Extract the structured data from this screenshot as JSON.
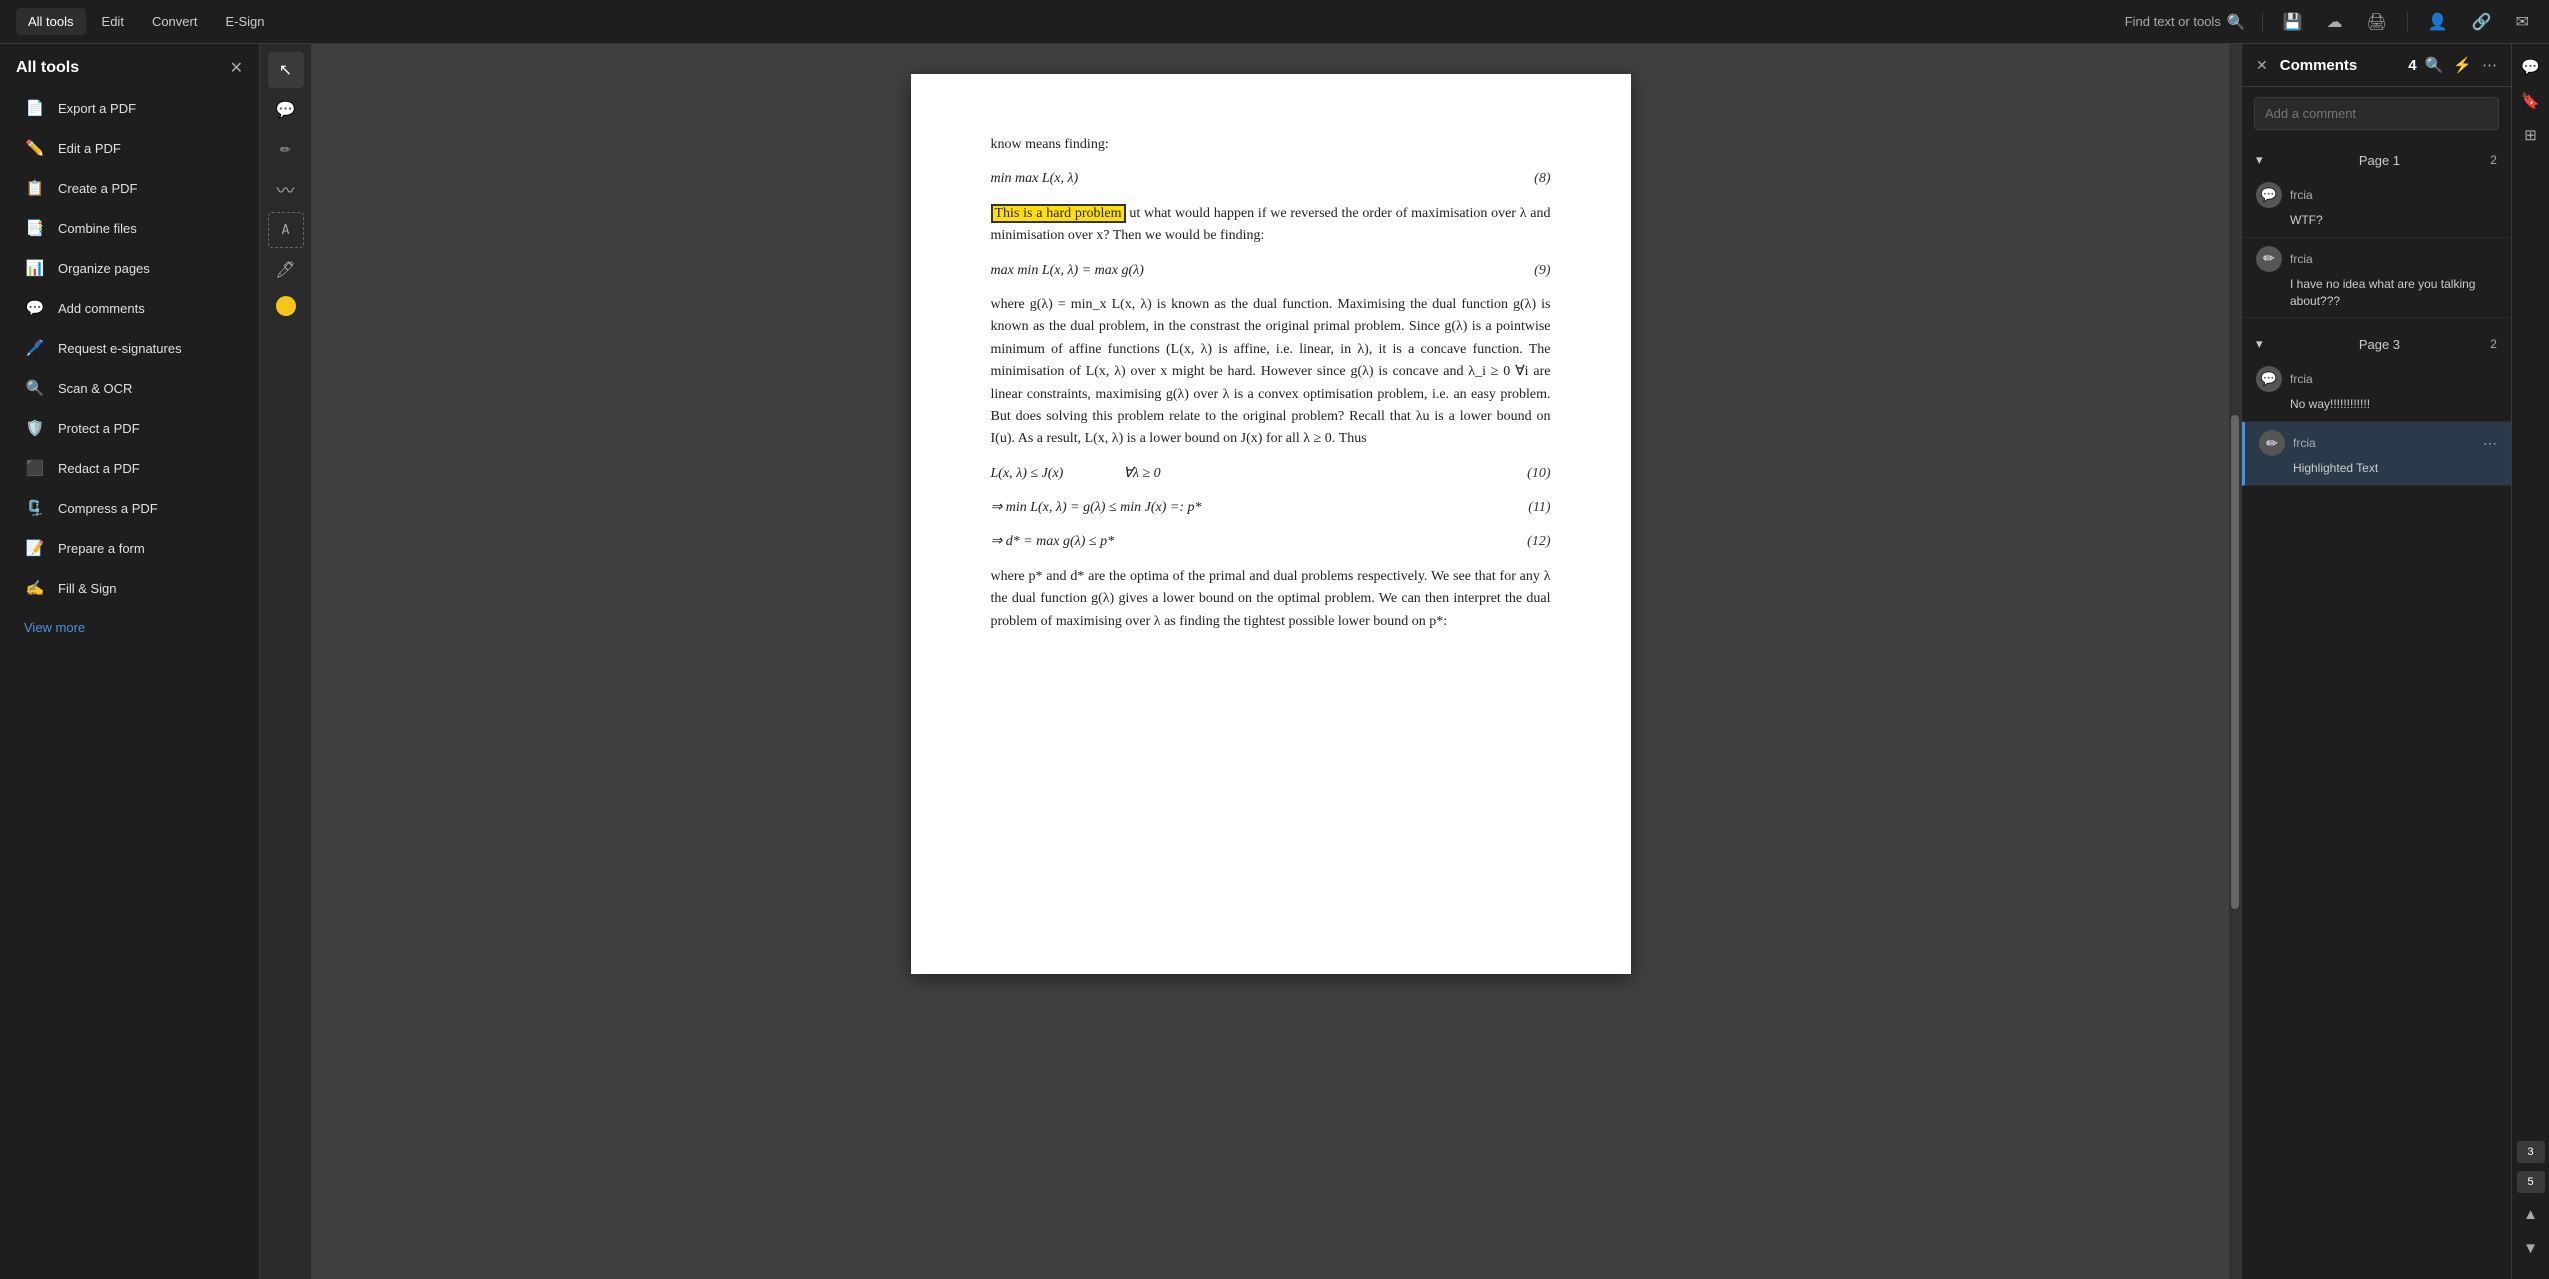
{
  "topbar": {
    "tabs": [
      {
        "label": "All tools",
        "active": true
      },
      {
        "label": "Edit",
        "active": false
      },
      {
        "label": "Convert",
        "active": false
      },
      {
        "label": "E-Sign",
        "active": false
      }
    ],
    "search_placeholder": "Find text or tools",
    "icons": [
      "save-icon",
      "upload-icon",
      "print-icon",
      "account-icon",
      "link-icon",
      "email-icon"
    ]
  },
  "sidebar": {
    "title": "All tools",
    "tools": [
      {
        "id": "export-pdf",
        "label": "Export a PDF",
        "icon": "📄",
        "color": "icon-export"
      },
      {
        "id": "edit-pdf",
        "label": "Edit a PDF",
        "icon": "✏️",
        "color": "icon-edit"
      },
      {
        "id": "create-pdf",
        "label": "Create a PDF",
        "icon": "📋",
        "color": "icon-create"
      },
      {
        "id": "combine-files",
        "label": "Combine files",
        "icon": "📑",
        "color": "icon-combine"
      },
      {
        "id": "organize-pages",
        "label": "Organize pages",
        "icon": "📊",
        "color": "icon-organize"
      },
      {
        "id": "add-comments",
        "label": "Add comments",
        "icon": "💬",
        "color": "icon-comments"
      },
      {
        "id": "request-esign",
        "label": "Request e-signatures",
        "icon": "🖊️",
        "color": "icon-esign"
      },
      {
        "id": "scan-ocr",
        "label": "Scan & OCR",
        "icon": "🔍",
        "color": "icon-scan"
      },
      {
        "id": "protect-pdf",
        "label": "Protect a PDF",
        "icon": "🛡️",
        "color": "icon-protect"
      },
      {
        "id": "redact-pdf",
        "label": "Redact a PDF",
        "icon": "⬛",
        "color": "icon-redact"
      },
      {
        "id": "compress-pdf",
        "label": "Compress a PDF",
        "icon": "🗜️",
        "color": "icon-compress"
      },
      {
        "id": "prepare-form",
        "label": "Prepare a form",
        "icon": "📝",
        "color": "icon-prepare"
      },
      {
        "id": "fill-sign",
        "label": "Fill & Sign",
        "icon": "✍️",
        "color": "icon-fill"
      }
    ],
    "view_more": "View more"
  },
  "toolstrip": {
    "buttons": [
      {
        "id": "cursor",
        "icon": "↖",
        "active": true
      },
      {
        "id": "comment-bubble",
        "icon": "💬",
        "active": false
      },
      {
        "id": "pen",
        "icon": "✏️",
        "active": false
      },
      {
        "id": "squiggle",
        "icon": "〰",
        "active": false
      },
      {
        "id": "text-select",
        "icon": "T",
        "active": false
      },
      {
        "id": "highlighter",
        "icon": "🖊",
        "active": false
      },
      {
        "id": "color-dot",
        "icon": "",
        "active": false,
        "special": "yellow-dot"
      }
    ]
  },
  "pdf": {
    "content_before": "know means finding:",
    "equation_8": "min max L(x, λ)",
    "equation_8_num": "(8)",
    "highlighted_text": "This is a hard problem",
    "paragraph_after_highlight": "ut what would happen if we reversed the order of maximisation over λ and minimisation over x? Then we would be finding:",
    "equation_9_label": "max min L(x, λ) = max g(λ)",
    "equation_9_num": "(9)",
    "paragraph_dual": "where g(λ) = min_x L(x, λ) is known as the dual function. Maximising the dual function g(λ) is known as the dual problem, in the constrast the original primal problem. Since g(λ) is a pointwise minimum of affine functions (L(x, λ) is affine, i.e. linear, in λ), it is a concave function. The minimisation of L(x, λ) over x might be hard. However since g(λ) is concave and λ_i ≥ 0 ∀i are linear constraints, maximising g(λ) over λ is a convex optimisation problem, i.e. an easy problem. But does solving this problem relate to the original problem? Recall that λu is a lower bound on I(u). As a result, L(x, λ) is a lower bound on J(x) for all λ ≥ 0. Thus",
    "equation_10": "L(x, λ) ≤ J(x)",
    "equation_10_right": "∀λ ≥ 0",
    "equation_10_num": "(10)",
    "equation_11": "⇒ min L(x, λ) = g(λ) ≤ min J(x) =: p*",
    "equation_11_num": "(11)",
    "equation_12": "⇒ d* = max g(λ) ≤ p*",
    "equation_12_num": "(12)",
    "paragraph_conclusion": "where p* and d* are the optima of the primal and dual problems respectively. We see that for any λ the dual function g(λ) gives a lower bound on the optimal problem. We can then interpret the dual problem of maximising over λ as finding the tightest possible lower bound on p*:"
  },
  "comments_panel": {
    "title": "Comments",
    "count": "4",
    "add_placeholder": "Add a comment",
    "page_groups": [
      {
        "label": "Page 1",
        "count": "2",
        "comments": [
          {
            "author": "frcia",
            "text": "WTF?",
            "avatar_type": "bubble",
            "active": false
          },
          {
            "author": "frcia",
            "text": "I have no idea what are you talking about???",
            "avatar_type": "edit",
            "active": false
          }
        ]
      },
      {
        "label": "Page 3",
        "count": "2",
        "comments": [
          {
            "author": "frcia",
            "text": "No way!!!!!!!!!!!!",
            "avatar_type": "bubble",
            "active": false
          },
          {
            "author": "frcia",
            "text": "Highlighted Text",
            "avatar_type": "edit",
            "active": true
          }
        ]
      }
    ]
  },
  "far_right": {
    "buttons": [
      {
        "id": "comment-panel",
        "icon": "💬",
        "active": true
      },
      {
        "id": "bookmark",
        "icon": "🔖",
        "active": false
      },
      {
        "id": "panels",
        "icon": "⊞",
        "active": false
      }
    ],
    "page_numbers": [
      "3",
      "5"
    ],
    "chevrons": [
      "▲",
      "▼"
    ]
  }
}
